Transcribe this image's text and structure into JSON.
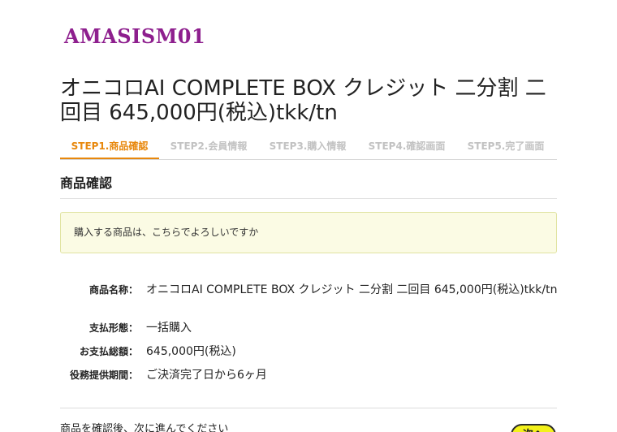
{
  "header": {
    "logo_text": "AMASISM01"
  },
  "product_title": "オニコロAI COMPLETE BOX クレジット 二分割 二回目 645,000円(税込)tkk/tn",
  "steps": [
    {
      "label": "STEP1.商品確認",
      "active": true
    },
    {
      "label": "STEP2.会員情報",
      "active": false
    },
    {
      "label": "STEP3.購入情報",
      "active": false
    },
    {
      "label": "STEP4.確認画面",
      "active": false
    },
    {
      "label": "STEP5.完了画面",
      "active": false
    }
  ],
  "section_title": "商品確認",
  "notice": "購入する商品は、こちらでよろしいですか",
  "details": {
    "product_name_label": "商品名称：",
    "product_name_value": "オニコロAI COMPLETE BOX クレジット 二分割 二回目 645,000円(税込)tkk/tn",
    "payment_type_label": "支払形態：",
    "payment_type_value": "一括購入",
    "total_label": "お支払総額：",
    "total_value": "645,000円(税込)",
    "service_period_label": "役務提供期間：",
    "service_period_value": "ご決済完了日から6ヶ月"
  },
  "footer": {
    "instruction": "商品を確認後、次に進んでください",
    "next_label": "次へ"
  },
  "colors": {
    "brand": "#8e1f8e",
    "active_step": "#e8870b",
    "inactive_step": "#c2c2c2",
    "notice_bg": "#fbfbe4",
    "next_button_bg": "#f3f11a"
  }
}
